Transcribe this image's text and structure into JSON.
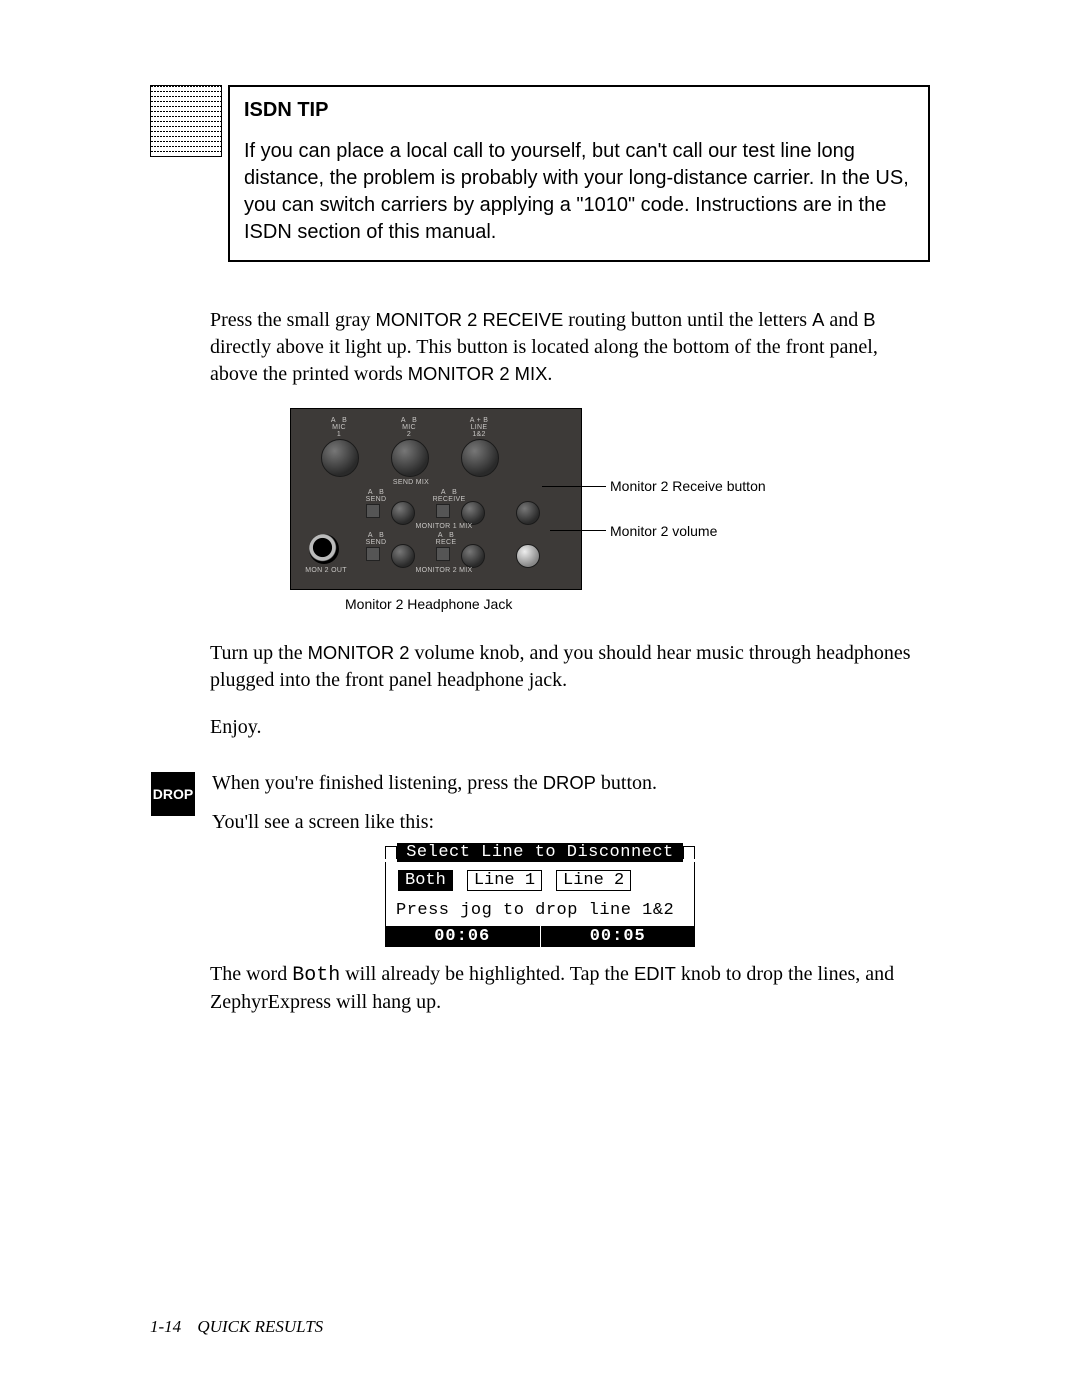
{
  "tip": {
    "title": "ISDN TIP",
    "body": "If you can place a local call to yourself, but can't call our test line long distance, the problem is probably with your long-distance carrier. In the US, you can switch carriers by applying a \"1010\" code. Instructions are in the ISDN section of this manual."
  },
  "para1_a": "Press the small gray ",
  "para1_sc1": "MONITOR 2 RECEIVE",
  "para1_b": " routing button until the letters ",
  "para1_sc2": "A",
  "para1_c": " and ",
  "para1_sc3": "B",
  "para1_d": " directly above it light up. This button is located along the bottom of the front panel, above the printed words ",
  "para1_sc4": "MONITOR 2 MIX",
  "para1_e": ".",
  "figure": {
    "label1": "Monitor 2 Receive button",
    "label2": "Monitor 2 volume",
    "caption": "Monitor 2 Headphone Jack",
    "panel_labels": {
      "k1": "A   B\nMIC\n1",
      "k2": "A   B\nMIC\n2",
      "k3": "A + B\nLINE\n1&2",
      "row1": "SEND MIX",
      "row2l": "A   B\nSEND",
      "row2r": "A   B\nRECEIVE",
      "row2": "MONITOR 1 MIX",
      "row3l": "A   B\nSEND",
      "row3r": "A   B\nRECE",
      "row3": "MONITOR 2 MIX",
      "out": "MON 2 OUT"
    }
  },
  "para2_a": "Turn up the ",
  "para2_sc": "MONITOR 2",
  "para2_b": " volume knob, and you should hear music through headphones plugged into the front panel headphone jack.",
  "para3": "Enjoy.",
  "drop": {
    "button": "DROP",
    "line1_a": "When you're finished listening, press the ",
    "line1_sc": "DROP",
    "line1_b": " button.",
    "line2": "You'll see a screen like this:"
  },
  "lcd": {
    "title": "Select Line to Disconnect",
    "opt1": "Both",
    "opt2": "Line 1",
    "opt3": "Line 2",
    "hint": "Press jog to drop line 1&2",
    "time1": "00:06",
    "time2": "00:05"
  },
  "para4_a": "The word ",
  "para4_code": "Both",
  "para4_b": " will already be highlighted. Tap the ",
  "para4_sc": "EDIT",
  "para4_c": " knob to drop the lines, and ZephyrExpress will hang up.",
  "footer": {
    "page": "1-14",
    "section": "QUICK RESULTS"
  }
}
